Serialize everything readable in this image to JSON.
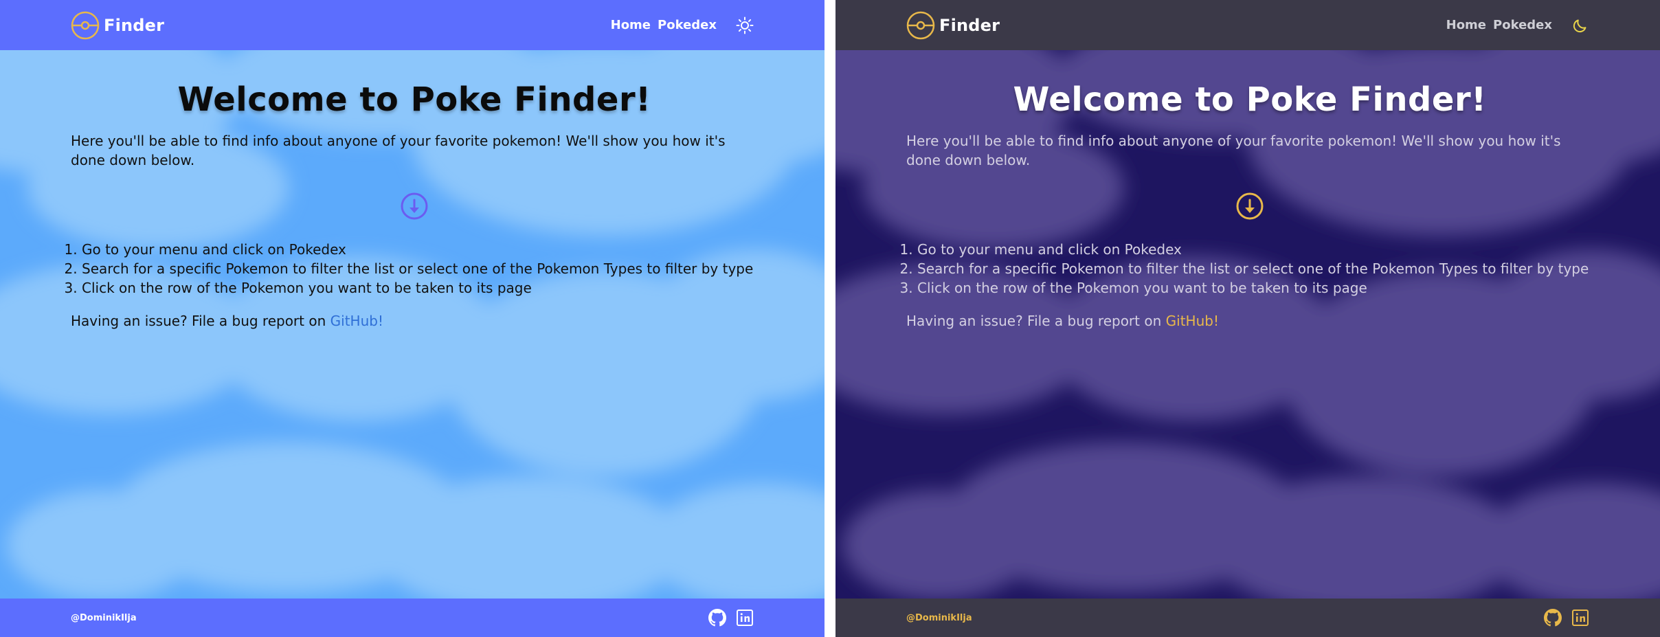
{
  "theme_colors": {
    "light_nav": "#5c6efe",
    "light_background": "#5caafb",
    "light_link": "#2f6fd6",
    "dark_nav": "#3b3948",
    "dark_background": "#1e1560",
    "dark_accent": "#e8b84a"
  },
  "light": {
    "brand": {
      "name": "Finder",
      "logo_icon": "pokeball-icon"
    },
    "nav": {
      "home": "Home",
      "pokedex": "Pokedex",
      "theme_icon": "sun-icon"
    },
    "main": {
      "title": "Welcome to Poke Finder!",
      "intro": "Here you'll be able to find info about anyone of your favorite pokemon! We'll show you how it's done down below.",
      "scroll_icon": "arrow-down-circle-icon",
      "steps": [
        "Go to your menu and click on Pokedex",
        "Search for a specific Pokemon to filter the list or select one of the Pokemon Types to filter by type",
        "Click on the row of the Pokemon you want to be taken to its page"
      ],
      "issue_text": "Having an issue? File a bug report on ",
      "issue_link": "GitHub!"
    },
    "footer": {
      "handle": "@DominikIlja",
      "icons": [
        "github-icon",
        "linkedin-icon"
      ]
    }
  },
  "dark": {
    "brand": {
      "name": "Finder",
      "logo_icon": "pokeball-icon"
    },
    "nav": {
      "home": "Home",
      "pokedex": "Pokedex",
      "theme_icon": "moon-icon"
    },
    "main": {
      "title": "Welcome to Poke Finder!",
      "intro": "Here you'll be able to find info about anyone of your favorite pokemon! We'll show you how it's done down below.",
      "scroll_icon": "arrow-down-circle-icon",
      "steps": [
        "Go to your menu and click on Pokedex",
        "Search for a specific Pokemon to filter the list or select one of the Pokemon Types to filter by type",
        "Click on the row of the Pokemon you want to be taken to its page"
      ],
      "issue_text": "Having an issue? File a bug report on ",
      "issue_link": "GitHub!"
    },
    "footer": {
      "handle": "@DominikIlja",
      "icons": [
        "github-icon",
        "linkedin-icon"
      ]
    }
  }
}
